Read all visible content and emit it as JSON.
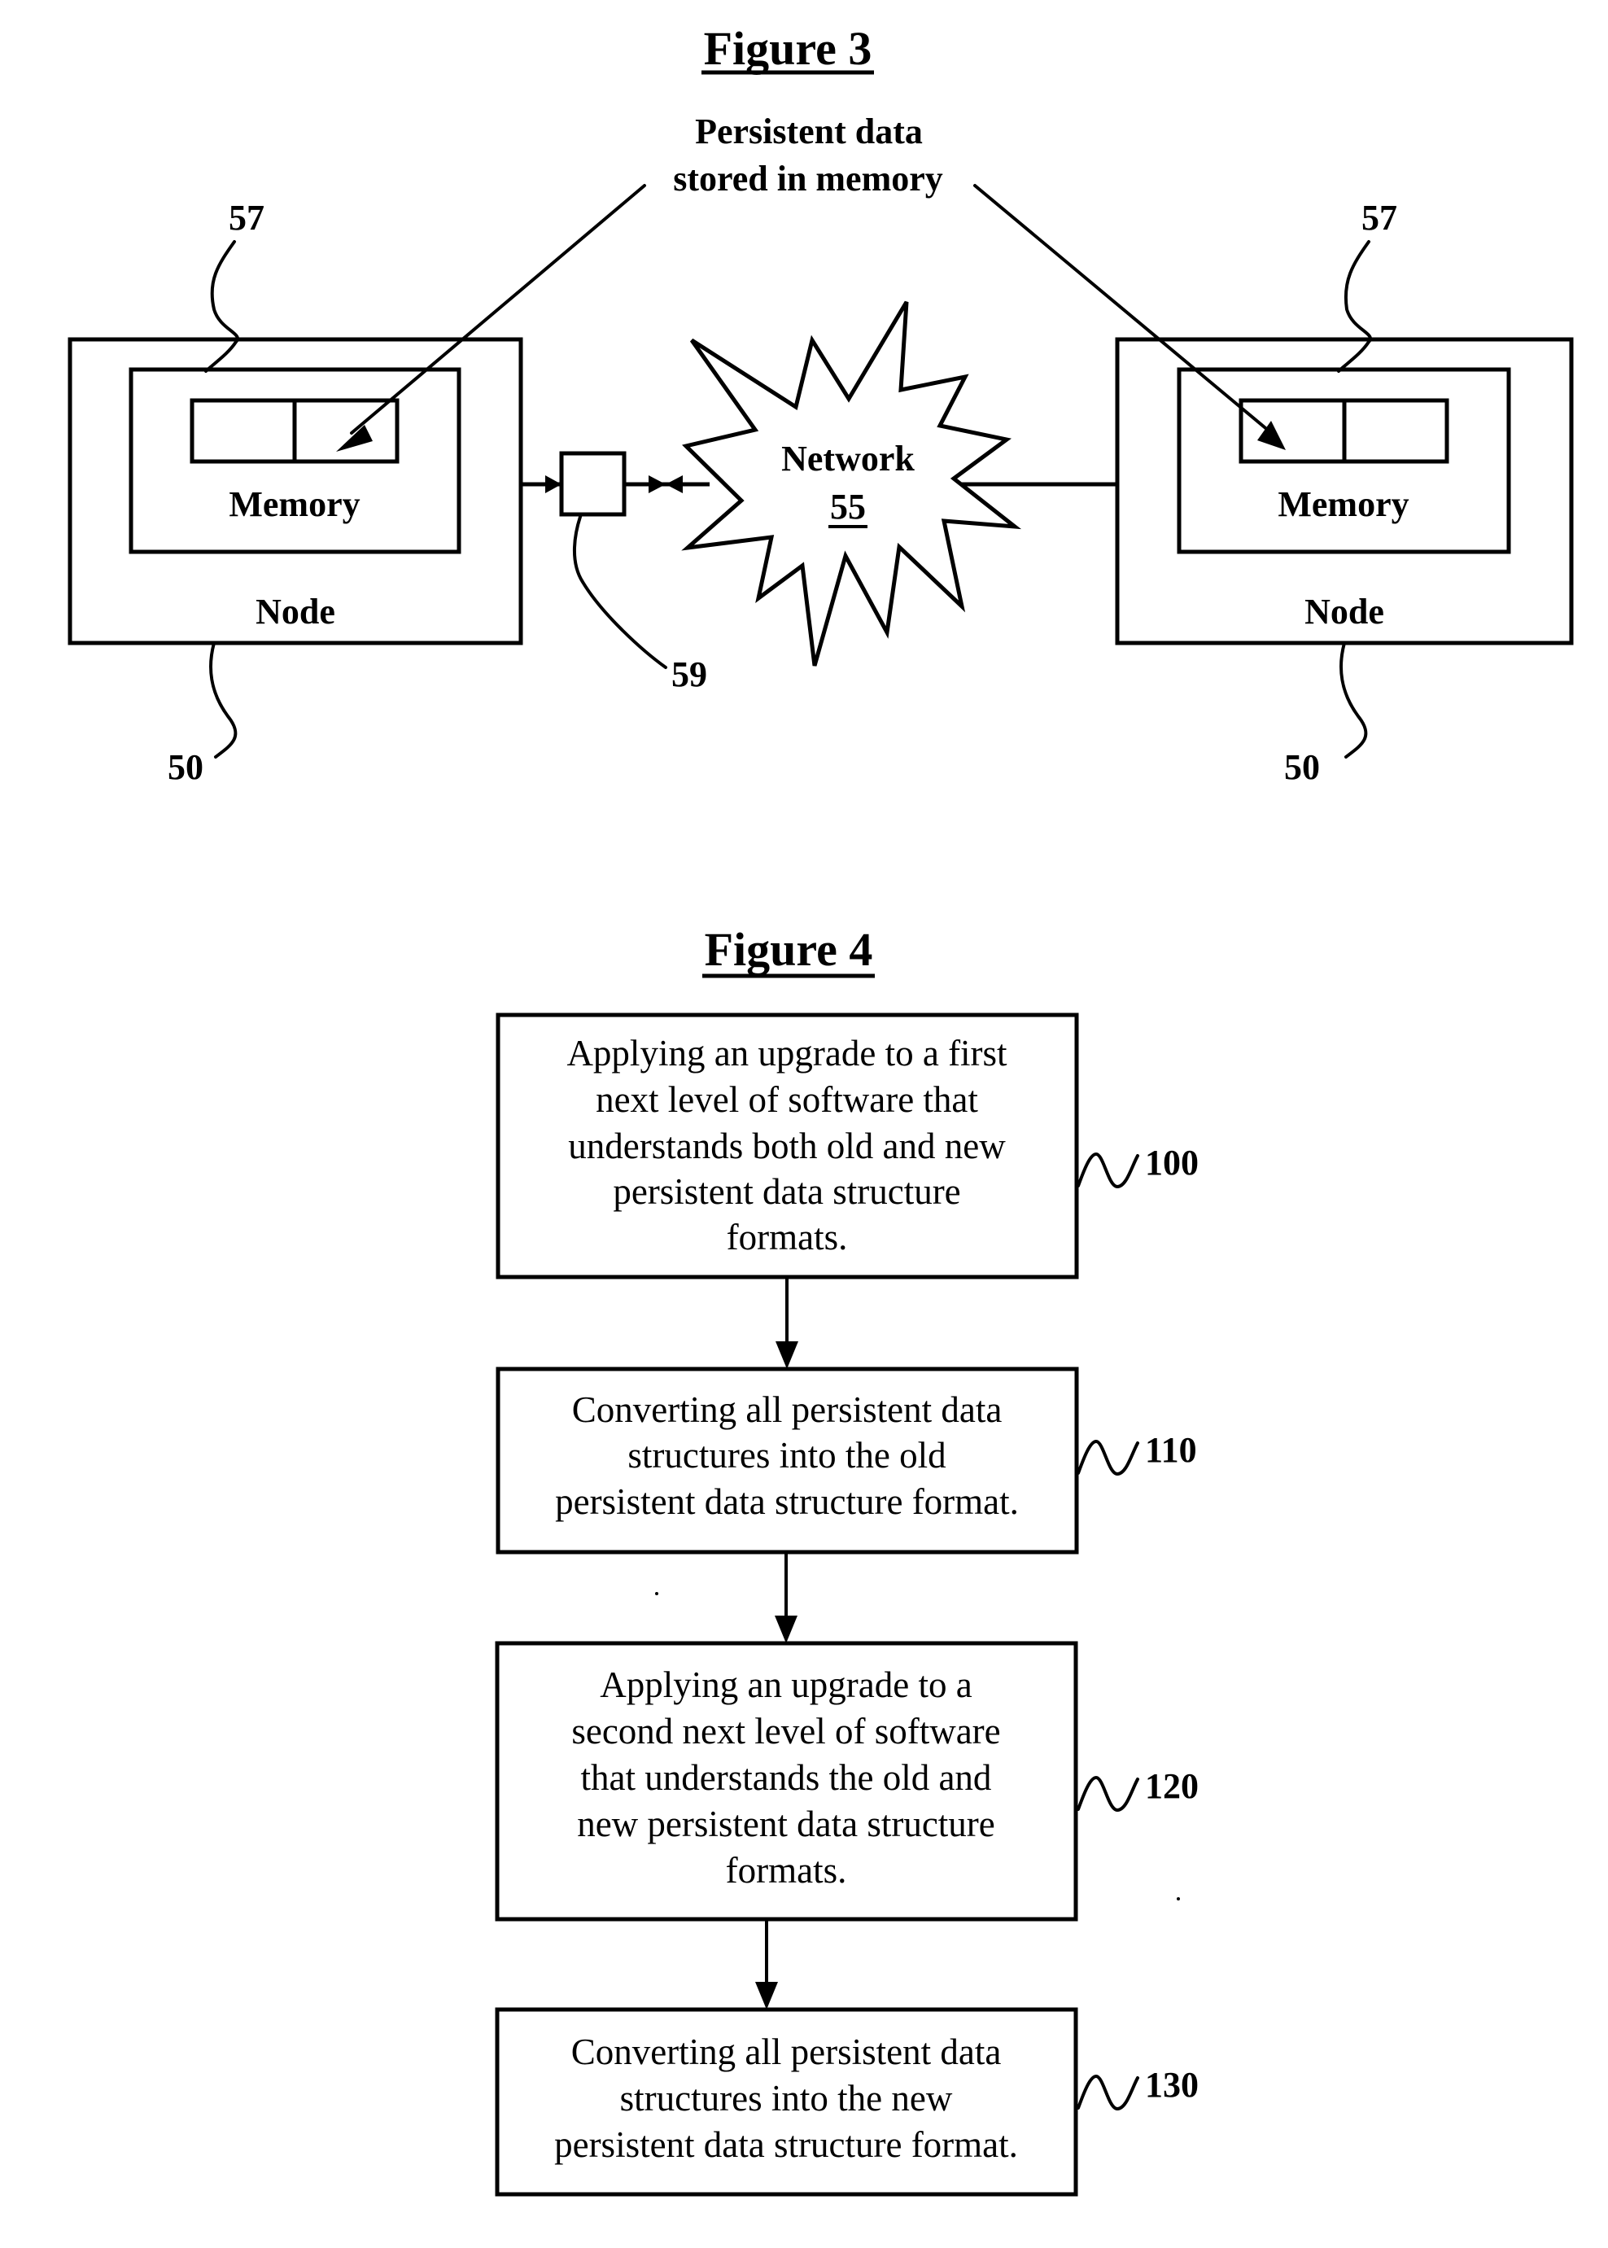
{
  "figure3": {
    "title": "Figure 3",
    "callout": {
      "line1": "Persistent data",
      "line2": "stored in memory"
    },
    "left_node": {
      "memory_label": "Memory",
      "node_label": "Node",
      "memory_ref": "57",
      "node_ref": "50"
    },
    "right_node": {
      "memory_label": "Memory",
      "node_label": "Node",
      "memory_ref": "57",
      "node_ref": "50"
    },
    "network": {
      "label": "Network",
      "ref": "55"
    },
    "interface_ref": "59"
  },
  "figure4": {
    "title": "Figure 4",
    "steps": [
      {
        "ref": "100",
        "lines": [
          "Applying an upgrade to a first",
          "next level of software that",
          "understands both old and new",
          "persistent data structure",
          "formats."
        ]
      },
      {
        "ref": "110",
        "lines": [
          "Converting all persistent data",
          "structures into the old",
          "persistent data structure format."
        ]
      },
      {
        "ref": "120",
        "lines": [
          "Applying an upgrade to a",
          "second next level of software",
          "that understands the old and",
          "new persistent data structure",
          "formats."
        ]
      },
      {
        "ref": "130",
        "lines": [
          "Converting all persistent data",
          "structures into the new",
          "persistent data structure format."
        ]
      }
    ]
  }
}
